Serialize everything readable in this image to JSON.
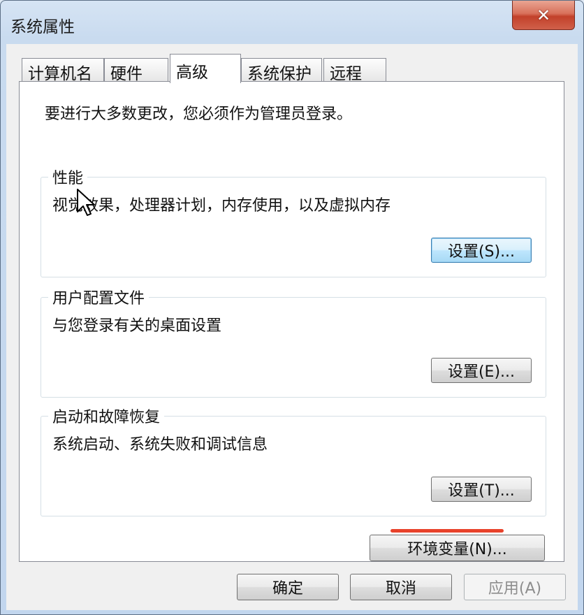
{
  "window": {
    "title": "系统属性",
    "close_label": "✕"
  },
  "tabs": [
    {
      "label": "计算机名"
    },
    {
      "label": "硬件"
    },
    {
      "label": "高级"
    },
    {
      "label": "系统保护"
    },
    {
      "label": "远程"
    }
  ],
  "panel": {
    "intro": "要进行大多数更改，您必须作为管理员登录。",
    "performance": {
      "title": "性能",
      "description": "视觉效果，处理器计划，内存使用，以及虚拟内存",
      "button": "设置(S)..."
    },
    "user_profiles": {
      "title": "用户配置文件",
      "description": "与您登录有关的桌面设置",
      "button": "设置(E)..."
    },
    "startup_recovery": {
      "title": "启动和故障恢复",
      "description": "系统启动、系统失败和调试信息",
      "button": "设置(T)..."
    },
    "env_button": "环境变量(N)..."
  },
  "footer": {
    "ok": "确定",
    "cancel": "取消",
    "apply": "应用(A)"
  },
  "colors": {
    "highlight_underline": "#e8422b",
    "focus_border": "#3c7fb1"
  }
}
